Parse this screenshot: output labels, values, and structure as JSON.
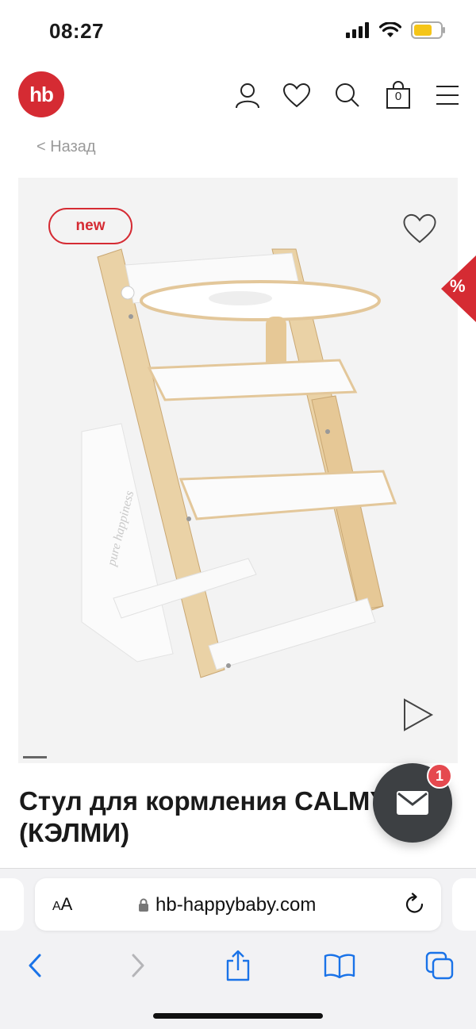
{
  "status_bar": {
    "time": "08:27"
  },
  "header": {
    "logo_text": "hb",
    "cart_count": "0",
    "icons": [
      "user-icon",
      "heart-icon",
      "search-icon",
      "cart-icon",
      "menu-icon"
    ]
  },
  "back_link": "< Назад",
  "product": {
    "badge": "new",
    "title": "Стул для кормления CALMY (КЭЛМИ)",
    "sale_tab": "%",
    "chair_text": "pure happiness"
  },
  "chat": {
    "unread_count": "1"
  },
  "browser": {
    "aa_label_small": "A",
    "aa_label_big": "A",
    "url": "hb-happybaby.com"
  },
  "colors": {
    "brand": "#d52b33",
    "fab": "#3d4043",
    "ios_blue": "#1a73e8"
  }
}
